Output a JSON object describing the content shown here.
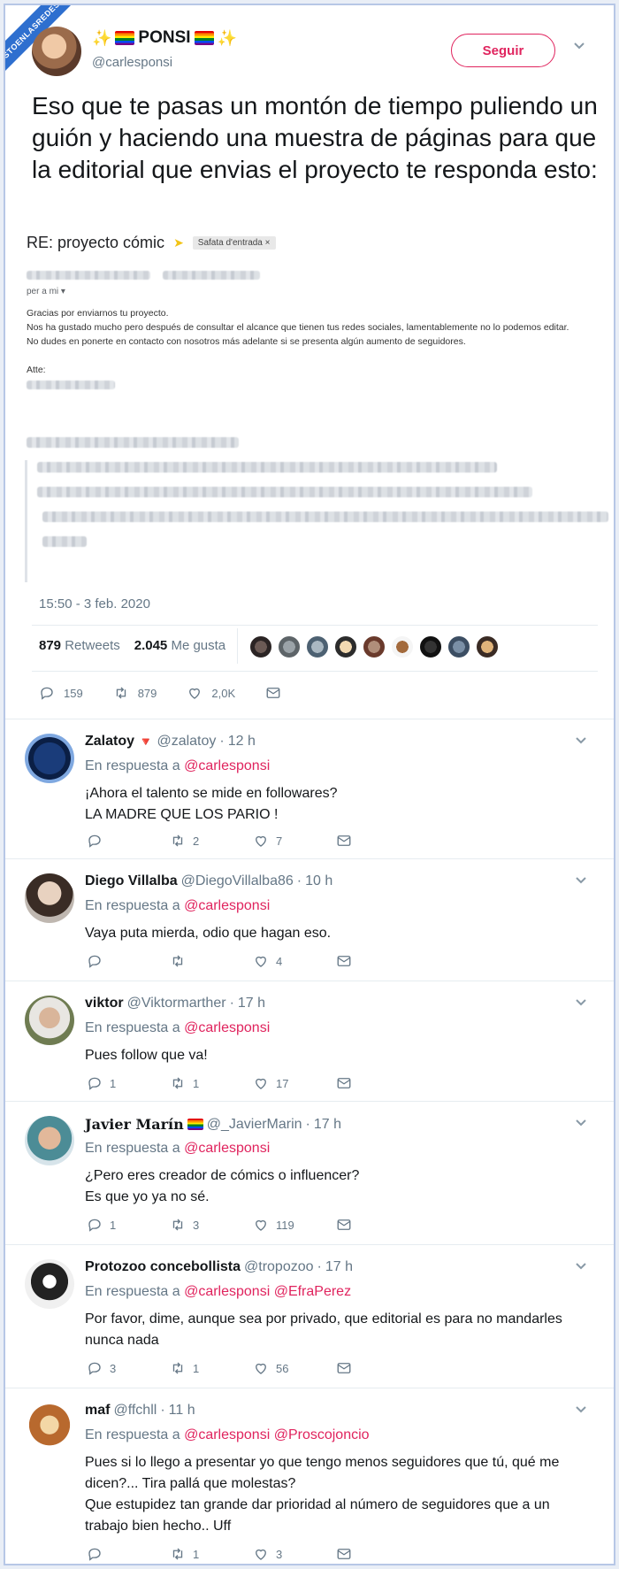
{
  "watermark": "VISTOENLASREDES.COM",
  "tweet": {
    "display_name": "PONSI",
    "handle": "@carlesponsi",
    "follow_label": "Seguir",
    "text": "Eso que te pasas un montón de tiempo puliendo un guión y haciendo una muestra de páginas para que la editorial que envias el proyecto te responda esto:",
    "timestamp": "15:50 - 3 feb. 2020",
    "retweets_count": "879",
    "retweets_label": "Retweets",
    "likes_count": "2.045",
    "likes_label": "Me gusta",
    "actions": {
      "replies": "159",
      "retweets": "879",
      "likes": "2,0K"
    }
  },
  "email": {
    "subject": "RE: proyecto cómic",
    "label": "Safata d'entrada",
    "to": "per a mi",
    "lines": [
      "Gracias por enviarnos tu proyecto.",
      "Nos ha gustado mucho pero después de consultar el alcance que tienen tus redes sociales,  lamentablemente no lo podemos editar.",
      "No dudes en ponerte en contacto con nosotros más adelante si se presenta algún aumento de seguidores."
    ],
    "signoff": "Atte:"
  },
  "replies": [
    {
      "name": "Zalatoy",
      "handle": "@zalatoy",
      "time": "12 h",
      "in_reply_prefix": "En respuesta a",
      "mentions": "@carlesponsi",
      "lines": [
        "¡Ahora el talento se mide en followares?",
        "LA MADRE QUE LOS PARIO !"
      ],
      "counts": {
        "replies": "",
        "retweets": "2",
        "likes": "7"
      }
    },
    {
      "name": "Diego Villalba",
      "handle": "@DiegoVillalba86",
      "time": "10 h",
      "in_reply_prefix": "En respuesta a",
      "mentions": "@carlesponsi",
      "lines": [
        "Vaya puta mierda, odio que hagan eso."
      ],
      "counts": {
        "replies": "",
        "retweets": "",
        "likes": "4"
      }
    },
    {
      "name": "viktor",
      "handle": "@Viktormarther",
      "time": "17 h",
      "in_reply_prefix": "En respuesta a",
      "mentions": "@carlesponsi",
      "lines": [
        "Pues follow que va!"
      ],
      "counts": {
        "replies": "1",
        "retweets": "1",
        "likes": "17"
      }
    },
    {
      "name": "Javier Marín",
      "handle": "@_JavierMarin",
      "time": "17 h",
      "in_reply_prefix": "En respuesta a",
      "mentions": "@carlesponsi",
      "lines": [
        "¿Pero eres creador de cómics o influencer?",
        "Es que yo ya no sé."
      ],
      "counts": {
        "replies": "1",
        "retweets": "3",
        "likes": "119"
      }
    },
    {
      "name": "Protozoo concebollista",
      "handle": "@tropozoo",
      "time": "17 h",
      "in_reply_prefix": "En respuesta a",
      "mentions": "@carlesponsi @EfraPerez",
      "lines": [
        "Por favor, dime, aunque sea por privado, que editorial es para no mandarles",
        "nunca nada"
      ],
      "counts": {
        "replies": "3",
        "retweets": "1",
        "likes": "56"
      }
    },
    {
      "name": "maf",
      "handle": "@ffchll",
      "time": "11 h",
      "in_reply_prefix": "En respuesta a",
      "mentions": "@carlesponsi @Proscojoncio",
      "lines": [
        "Pues si lo llego a presentar yo que tengo menos seguidores que tú, qué me",
        "dicen?... Tira pallá que molestas?",
        "Que estupidez tan grande dar prioridad al número de seguidores que a un",
        "trabajo bien hecho.. Uff"
      ],
      "counts": {
        "replies": "",
        "retweets": "1",
        "likes": "3"
      }
    }
  ],
  "colors": {
    "accent": "#e0245e",
    "muted": "#657786",
    "brand_ribbon": "#2e6fcf"
  }
}
